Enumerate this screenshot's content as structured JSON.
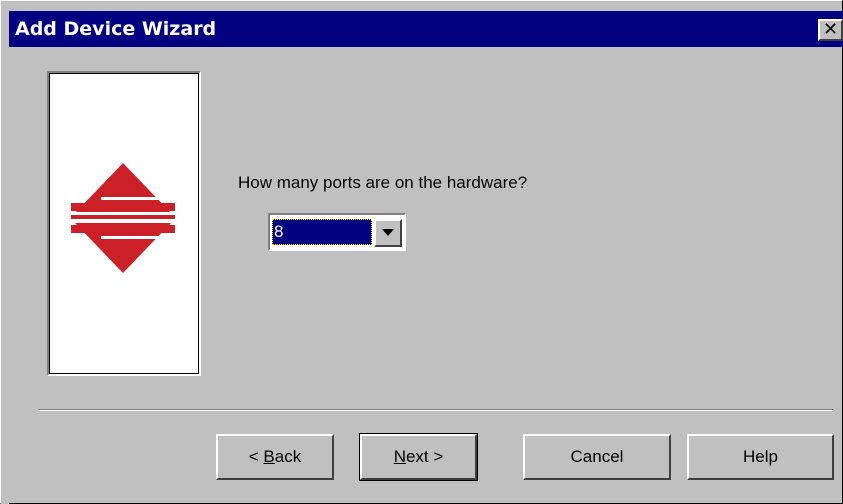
{
  "window": {
    "title": "Add Device Wizard",
    "close_glyph": "✕"
  },
  "wizard": {
    "question": "How many ports are on the hardware?",
    "ports_select": {
      "selected_value": "8"
    }
  },
  "buttons": {
    "back_prefix": "< ",
    "back_mnemonic": "B",
    "back_rest": "ack",
    "next_mnemonic": "N",
    "next_rest": "ext >",
    "cancel": "Cancel",
    "help": "Help"
  },
  "colors": {
    "titlebar": "#000080",
    "logo_red": "#cc2028",
    "dialog_face": "#c0c0c0"
  },
  "icons": {
    "logo": "red-double-arrow-logo",
    "dropdown": "triangle-down-icon",
    "close": "close-icon"
  }
}
